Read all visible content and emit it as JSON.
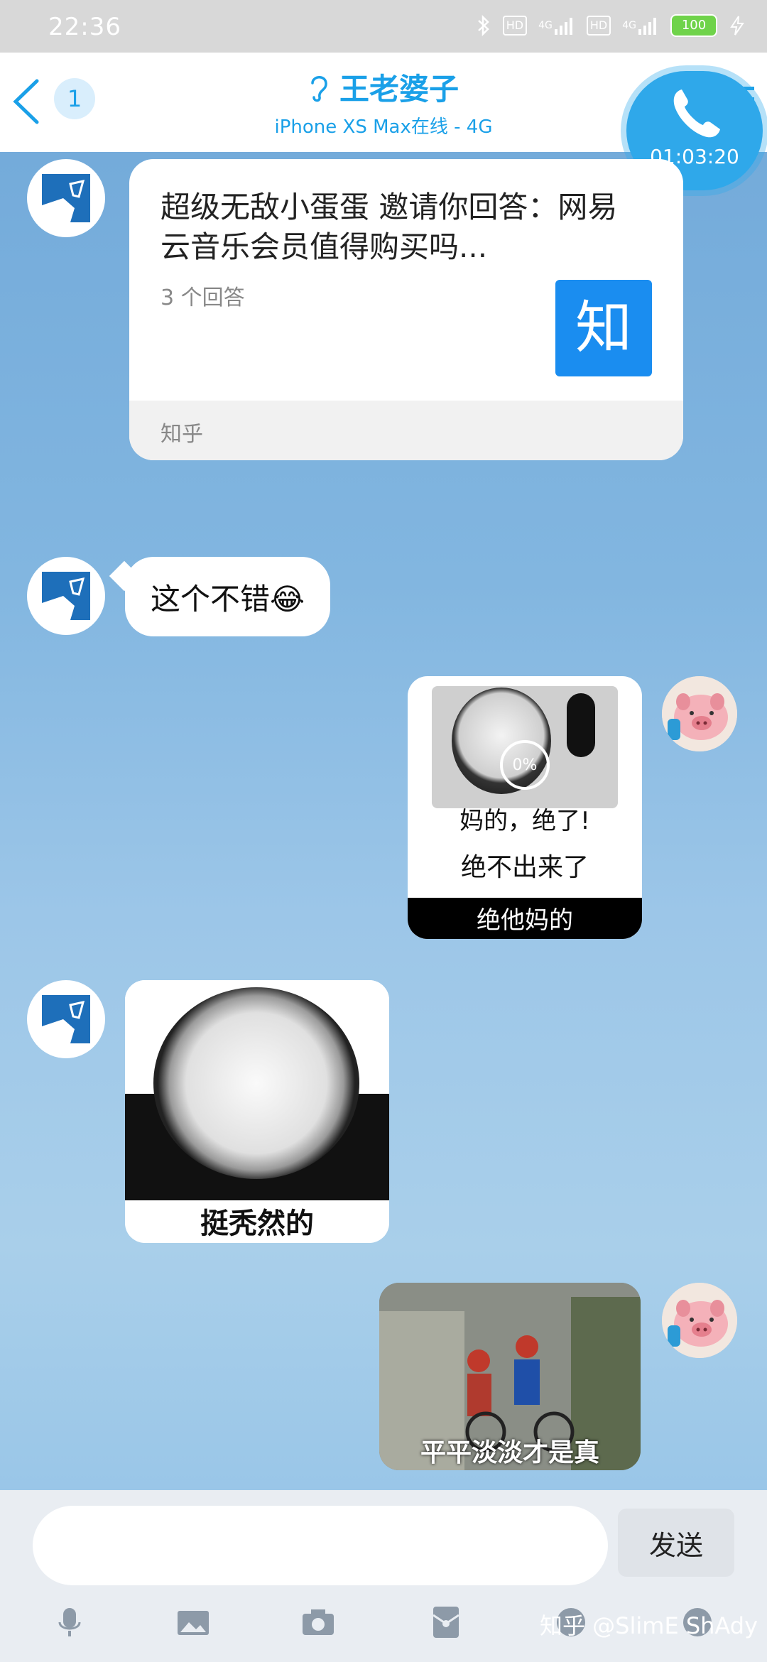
{
  "status_bar": {
    "time": "22:36",
    "hd1": "HD",
    "hd2": "HD",
    "net1": "4G",
    "net2": "4G",
    "battery": "100"
  },
  "header": {
    "unread_count": "1",
    "title": "王老婆子",
    "subtitle": "iPhone XS Max在线 - 4G"
  },
  "call": {
    "duration": "01:03:20"
  },
  "messages": {
    "zhihu_card": {
      "title": "超级无敌小蛋蛋 邀请你回答：网易云音乐会员值得购买吗...",
      "answers": "3 个回答",
      "logo_char": "知",
      "source": "知乎"
    },
    "text1": "这个不错😂",
    "sticker1": {
      "progress": "0%",
      "line1": "妈的，绝了!",
      "line2": "绝不出来了",
      "line3": "绝他妈的"
    },
    "sticker2": {
      "caption": "挺秃然的"
    },
    "sticker3": {
      "caption": "平平淡淡才是真"
    }
  },
  "composer": {
    "input_value": "",
    "send_label": "发送",
    "icons": [
      "microphone-icon",
      "image-icon",
      "camera-icon",
      "red-packet-icon",
      "emoji-icon",
      "more-icon"
    ]
  },
  "watermark": "知乎 @SlimE ShAdy",
  "colors": {
    "accent": "#1aa0e8",
    "zhihu": "#1a8df0",
    "call": "#2fa8ea"
  }
}
